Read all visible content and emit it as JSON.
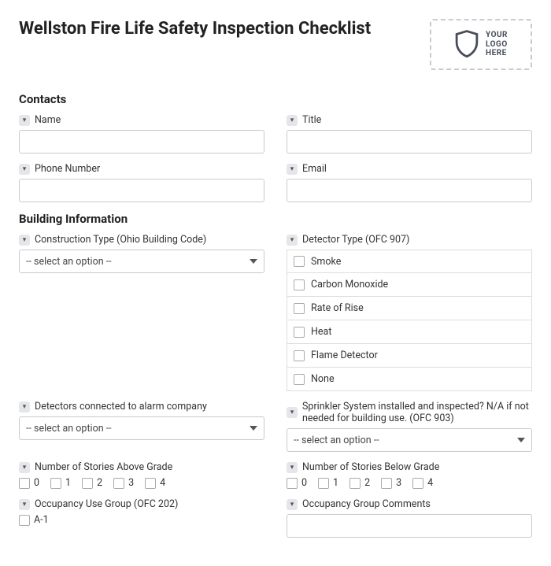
{
  "title": "Wellston Fire Life Safety Inspection Checklist",
  "logo": {
    "line1": "YOUR",
    "line2": "LOGO",
    "line3": "HERE"
  },
  "sections": {
    "contacts": {
      "heading": "Contacts",
      "fields": {
        "name": "Name",
        "title": "Title",
        "phone": "Phone Number",
        "email": "Email"
      }
    },
    "building": {
      "heading": "Building Information",
      "fields": {
        "construction": "Construction Type (Ohio Building Code)",
        "detector_type": "Detector Type (OFC 907)",
        "alarm_company": "Detectors connected to alarm company",
        "sprinkler": "Sprinkler System installed and inspected? N/A if not needed for building use. (OFC 903)",
        "stories_above": "Number of Stories Above Grade",
        "stories_below": "Number of Stories Below Grade",
        "occupancy_group": "Occupancy Use Group (OFC 202)",
        "occupancy_comments": "Occupancy Group Comments"
      },
      "select_placeholder": "-- select an option --",
      "detector_options": [
        "Smoke",
        "Carbon Monoxide",
        "Rate of Rise",
        "Heat",
        "Flame Detector",
        "None"
      ],
      "stories_options": [
        "0",
        "1",
        "2",
        "3",
        "4"
      ],
      "occupancy_visible": [
        "A-1"
      ]
    }
  }
}
